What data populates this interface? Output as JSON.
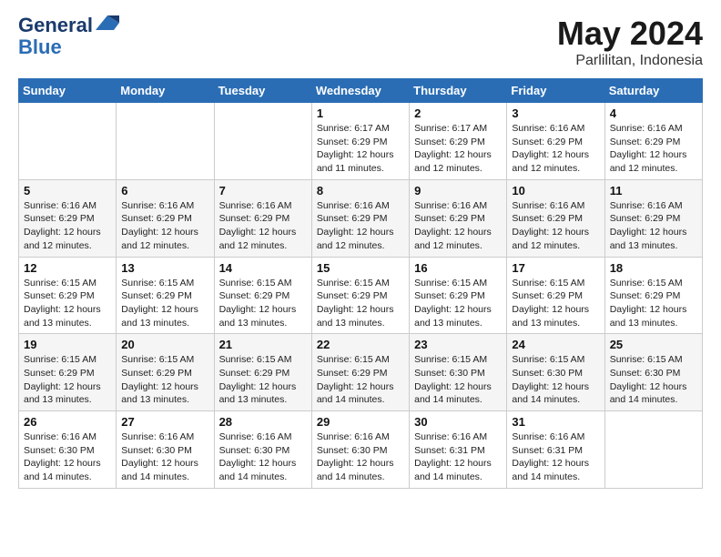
{
  "logo": {
    "line1": "General",
    "line2": "Blue"
  },
  "title": "May 2024",
  "subtitle": "Parlilitan, Indonesia",
  "header_days": [
    "Sunday",
    "Monday",
    "Tuesday",
    "Wednesday",
    "Thursday",
    "Friday",
    "Saturday"
  ],
  "weeks": [
    [
      {
        "day": "",
        "info": ""
      },
      {
        "day": "",
        "info": ""
      },
      {
        "day": "",
        "info": ""
      },
      {
        "day": "1",
        "info": "Sunrise: 6:17 AM\nSunset: 6:29 PM\nDaylight: 12 hours\nand 11 minutes."
      },
      {
        "day": "2",
        "info": "Sunrise: 6:17 AM\nSunset: 6:29 PM\nDaylight: 12 hours\nand 12 minutes."
      },
      {
        "day": "3",
        "info": "Sunrise: 6:16 AM\nSunset: 6:29 PM\nDaylight: 12 hours\nand 12 minutes."
      },
      {
        "day": "4",
        "info": "Sunrise: 6:16 AM\nSunset: 6:29 PM\nDaylight: 12 hours\nand 12 minutes."
      }
    ],
    [
      {
        "day": "5",
        "info": "Sunrise: 6:16 AM\nSunset: 6:29 PM\nDaylight: 12 hours\nand 12 minutes."
      },
      {
        "day": "6",
        "info": "Sunrise: 6:16 AM\nSunset: 6:29 PM\nDaylight: 12 hours\nand 12 minutes."
      },
      {
        "day": "7",
        "info": "Sunrise: 6:16 AM\nSunset: 6:29 PM\nDaylight: 12 hours\nand 12 minutes."
      },
      {
        "day": "8",
        "info": "Sunrise: 6:16 AM\nSunset: 6:29 PM\nDaylight: 12 hours\nand 12 minutes."
      },
      {
        "day": "9",
        "info": "Sunrise: 6:16 AM\nSunset: 6:29 PM\nDaylight: 12 hours\nand 12 minutes."
      },
      {
        "day": "10",
        "info": "Sunrise: 6:16 AM\nSunset: 6:29 PM\nDaylight: 12 hours\nand 12 minutes."
      },
      {
        "day": "11",
        "info": "Sunrise: 6:16 AM\nSunset: 6:29 PM\nDaylight: 12 hours\nand 13 minutes."
      }
    ],
    [
      {
        "day": "12",
        "info": "Sunrise: 6:15 AM\nSunset: 6:29 PM\nDaylight: 12 hours\nand 13 minutes."
      },
      {
        "day": "13",
        "info": "Sunrise: 6:15 AM\nSunset: 6:29 PM\nDaylight: 12 hours\nand 13 minutes."
      },
      {
        "day": "14",
        "info": "Sunrise: 6:15 AM\nSunset: 6:29 PM\nDaylight: 12 hours\nand 13 minutes."
      },
      {
        "day": "15",
        "info": "Sunrise: 6:15 AM\nSunset: 6:29 PM\nDaylight: 12 hours\nand 13 minutes."
      },
      {
        "day": "16",
        "info": "Sunrise: 6:15 AM\nSunset: 6:29 PM\nDaylight: 12 hours\nand 13 minutes."
      },
      {
        "day": "17",
        "info": "Sunrise: 6:15 AM\nSunset: 6:29 PM\nDaylight: 12 hours\nand 13 minutes."
      },
      {
        "day": "18",
        "info": "Sunrise: 6:15 AM\nSunset: 6:29 PM\nDaylight: 12 hours\nand 13 minutes."
      }
    ],
    [
      {
        "day": "19",
        "info": "Sunrise: 6:15 AM\nSunset: 6:29 PM\nDaylight: 12 hours\nand 13 minutes."
      },
      {
        "day": "20",
        "info": "Sunrise: 6:15 AM\nSunset: 6:29 PM\nDaylight: 12 hours\nand 13 minutes."
      },
      {
        "day": "21",
        "info": "Sunrise: 6:15 AM\nSunset: 6:29 PM\nDaylight: 12 hours\nand 13 minutes."
      },
      {
        "day": "22",
        "info": "Sunrise: 6:15 AM\nSunset: 6:29 PM\nDaylight: 12 hours\nand 14 minutes."
      },
      {
        "day": "23",
        "info": "Sunrise: 6:15 AM\nSunset: 6:30 PM\nDaylight: 12 hours\nand 14 minutes."
      },
      {
        "day": "24",
        "info": "Sunrise: 6:15 AM\nSunset: 6:30 PM\nDaylight: 12 hours\nand 14 minutes."
      },
      {
        "day": "25",
        "info": "Sunrise: 6:15 AM\nSunset: 6:30 PM\nDaylight: 12 hours\nand 14 minutes."
      }
    ],
    [
      {
        "day": "26",
        "info": "Sunrise: 6:16 AM\nSunset: 6:30 PM\nDaylight: 12 hours\nand 14 minutes."
      },
      {
        "day": "27",
        "info": "Sunrise: 6:16 AM\nSunset: 6:30 PM\nDaylight: 12 hours\nand 14 minutes."
      },
      {
        "day": "28",
        "info": "Sunrise: 6:16 AM\nSunset: 6:30 PM\nDaylight: 12 hours\nand 14 minutes."
      },
      {
        "day": "29",
        "info": "Sunrise: 6:16 AM\nSunset: 6:30 PM\nDaylight: 12 hours\nand 14 minutes."
      },
      {
        "day": "30",
        "info": "Sunrise: 6:16 AM\nSunset: 6:31 PM\nDaylight: 12 hours\nand 14 minutes."
      },
      {
        "day": "31",
        "info": "Sunrise: 6:16 AM\nSunset: 6:31 PM\nDaylight: 12 hours\nand 14 minutes."
      },
      {
        "day": "",
        "info": ""
      }
    ]
  ]
}
